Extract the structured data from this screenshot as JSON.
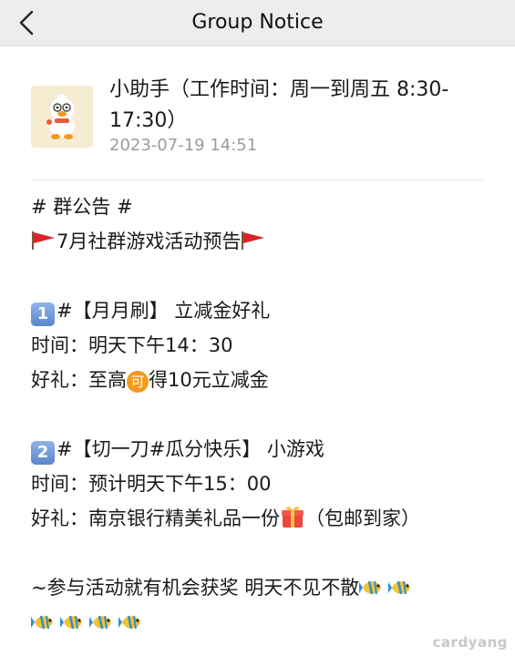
{
  "nav": {
    "back_icon": "chevron-left-icon",
    "title": "Group Notice"
  },
  "notice": {
    "sender_name": "小助手（工作时间：周一到周五 8:30-17:30）",
    "timestamp": "2023-07-19 14:51",
    "lines": {
      "l1": "# 群公告 #",
      "l2": "7月社群游戏活动预告",
      "l3": "#【月月刷】 立减金好礼",
      "l4": "时间：明天下午14：30",
      "l5a": "好礼：至高",
      "l5b": "得10元立减金",
      "l6": "#【切一刀#瓜分快乐】 小游戏",
      "l7": "时间：预计明天下午15：00",
      "l8a": "好礼：南京银行精美礼品一份",
      "l8b": "（包邮到家）",
      "l9": "~参与活动就有机会获奖 明天不见不散"
    },
    "badges": {
      "num1": "1",
      "num2": "2",
      "ke": "可"
    }
  },
  "watermark": "cardyang",
  "colors": {
    "nav_bg": "#ededed",
    "timestamp": "#9b9b9b",
    "flag": "#d9252a",
    "keycap": "#6f98da",
    "coin": "#f39a1e"
  }
}
